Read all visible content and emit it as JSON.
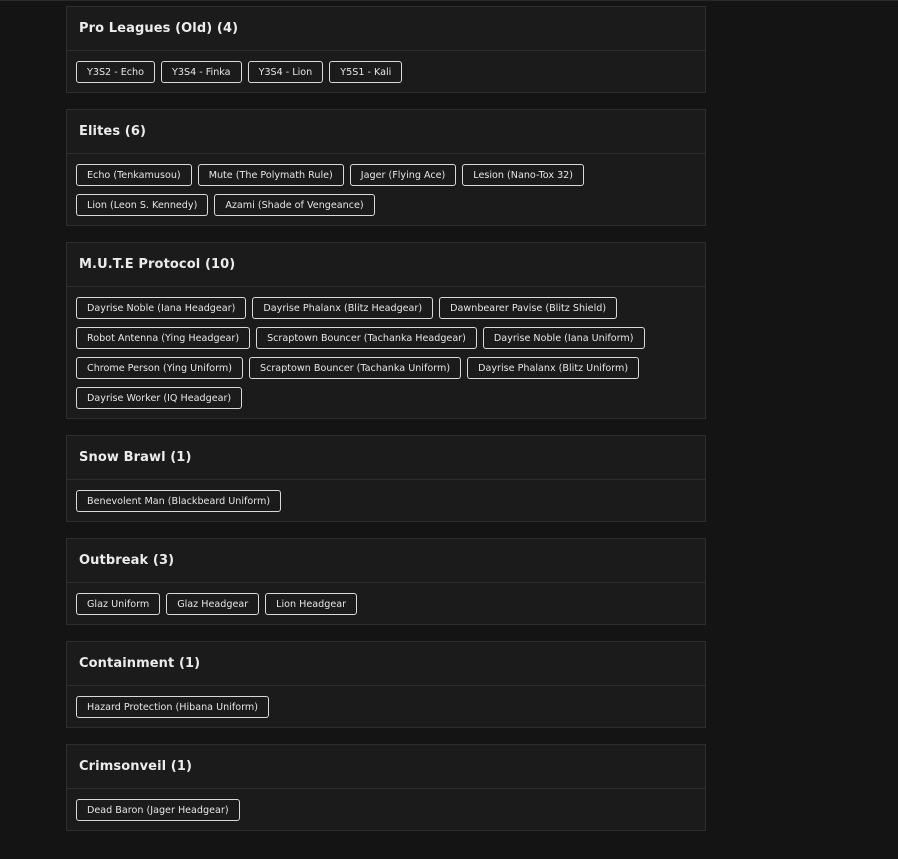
{
  "sections": [
    {
      "title": "Pro Leagues (Old) (4)",
      "items": [
        "Y3S2 - Echo",
        "Y3S4 - Finka",
        "Y3S4 - Lion",
        "Y5S1 - Kali"
      ]
    },
    {
      "title": "Elites (6)",
      "items": [
        "Echo (Tenkamusou)",
        "Mute (The Polymath Rule)",
        "Jager (Flying Ace)",
        "Lesion (Nano-Tox 32)",
        "Lion (Leon S. Kennedy)",
        "Azami (Shade of Vengeance)"
      ]
    },
    {
      "title": "M.U.T.E Protocol (10)",
      "items": [
        "Dayrise Noble (Iana Headgear)",
        "Dayrise Phalanx (Blitz Headgear)",
        "Dawnbearer Pavise (Blitz Shield)",
        "Robot Antenna (Ying Headgear)",
        "Scraptown Bouncer (Tachanka Headgear)",
        "Dayrise Noble (Iana Uniform)",
        "Chrome Person (Ying Uniform)",
        "Scraptown Bouncer (Tachanka Uniform)",
        "Dayrise Phalanx (Blitz Uniform)",
        "Dayrise Worker (IQ Headgear)"
      ]
    },
    {
      "title": "Snow Brawl (1)",
      "items": [
        "Benevolent Man (Blackbeard Uniform)"
      ]
    },
    {
      "title": "Outbreak (3)",
      "items": [
        "Glaz Uniform",
        "Glaz Headgear",
        "Lion Headgear"
      ]
    },
    {
      "title": "Containment (1)",
      "items": [
        "Hazard Protection (Hibana Uniform)"
      ]
    },
    {
      "title": "Crimsonveil (1)",
      "items": [
        "Dead Baron (Jager Headgear)"
      ]
    }
  ]
}
